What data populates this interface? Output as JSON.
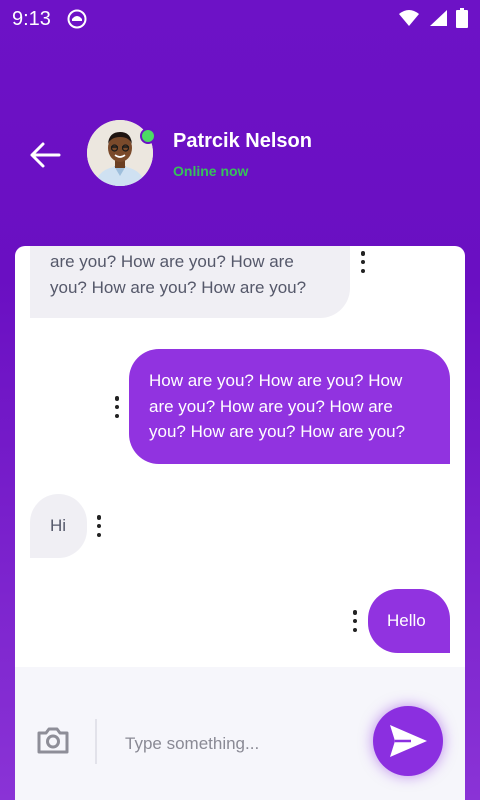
{
  "status_bar": {
    "time": "9:13"
  },
  "header": {
    "contact_name": "Patrcik Nelson",
    "contact_status": "Online now"
  },
  "messages": [
    {
      "direction": "incoming",
      "text": "are you? How are you? How are you? How are you? How are you?",
      "lines": [
        "are you? How are you? How are",
        "you? How are you? How are you?"
      ]
    },
    {
      "direction": "outgoing",
      "text": "How are you? How are you? How are you? How are you? How are you? How are you? How are you?",
      "lines": [
        "How are you? How are you? How",
        "are you? How are you? How are",
        "you? How are you? How are you?"
      ]
    },
    {
      "direction": "incoming",
      "text": "Hi"
    },
    {
      "direction": "outgoing",
      "text": "Hello"
    }
  ],
  "composer": {
    "placeholder": "Type something..."
  },
  "colors": {
    "accent": "#9133e0",
    "online": "#37c15a",
    "header_bg": "#6a0fc2"
  },
  "icons": [
    "back-arrow-icon",
    "camera-icon",
    "send-icon",
    "more-vert-icon",
    "wifi-icon",
    "signal-icon",
    "battery-icon"
  ]
}
